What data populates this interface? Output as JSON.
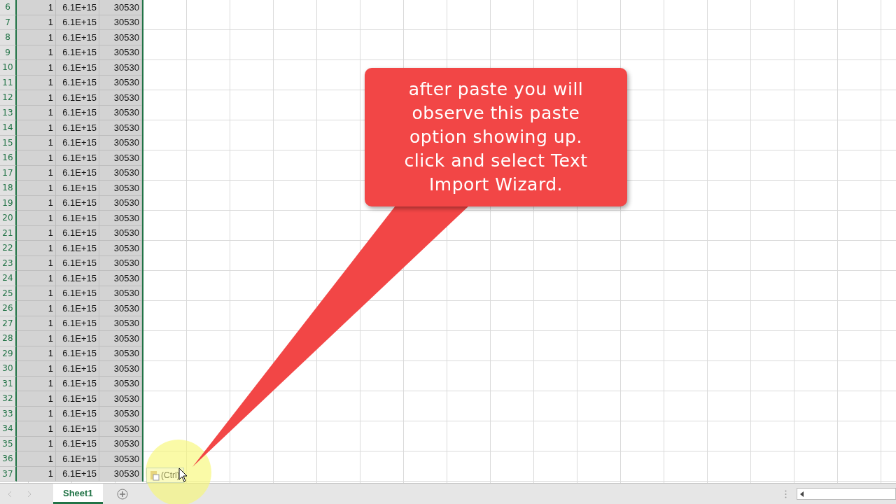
{
  "rows": [
    {
      "row": "6",
      "cells": [
        "1",
        "6.1E+15",
        "30530"
      ]
    },
    {
      "row": "7",
      "cells": [
        "1",
        "6.1E+15",
        "30530"
      ]
    },
    {
      "row": "8",
      "cells": [
        "1",
        "6.1E+15",
        "30530"
      ]
    },
    {
      "row": "9",
      "cells": [
        "1",
        "6.1E+15",
        "30530"
      ]
    },
    {
      "row": "10",
      "cells": [
        "1",
        "6.1E+15",
        "30530"
      ]
    },
    {
      "row": "11",
      "cells": [
        "1",
        "6.1E+15",
        "30530"
      ]
    },
    {
      "row": "12",
      "cells": [
        "1",
        "6.1E+15",
        "30530"
      ]
    },
    {
      "row": "13",
      "cells": [
        "1",
        "6.1E+15",
        "30530"
      ]
    },
    {
      "row": "14",
      "cells": [
        "1",
        "6.1E+15",
        "30530"
      ]
    },
    {
      "row": "15",
      "cells": [
        "1",
        "6.1E+15",
        "30530"
      ]
    },
    {
      "row": "16",
      "cells": [
        "1",
        "6.1E+15",
        "30530"
      ]
    },
    {
      "row": "17",
      "cells": [
        "1",
        "6.1E+15",
        "30530"
      ]
    },
    {
      "row": "18",
      "cells": [
        "1",
        "6.1E+15",
        "30530"
      ]
    },
    {
      "row": "19",
      "cells": [
        "1",
        "6.1E+15",
        "30530"
      ]
    },
    {
      "row": "20",
      "cells": [
        "1",
        "6.1E+15",
        "30530"
      ]
    },
    {
      "row": "21",
      "cells": [
        "1",
        "6.1E+15",
        "30530"
      ]
    },
    {
      "row": "22",
      "cells": [
        "1",
        "6.1E+15",
        "30530"
      ]
    },
    {
      "row": "23",
      "cells": [
        "1",
        "6.1E+15",
        "30530"
      ]
    },
    {
      "row": "24",
      "cells": [
        "1",
        "6.1E+15",
        "30530"
      ]
    },
    {
      "row": "25",
      "cells": [
        "1",
        "6.1E+15",
        "30530"
      ]
    },
    {
      "row": "26",
      "cells": [
        "1",
        "6.1E+15",
        "30530"
      ]
    },
    {
      "row": "27",
      "cells": [
        "1",
        "6.1E+15",
        "30530"
      ]
    },
    {
      "row": "28",
      "cells": [
        "1",
        "6.1E+15",
        "30530"
      ]
    },
    {
      "row": "29",
      "cells": [
        "1",
        "6.1E+15",
        "30530"
      ]
    },
    {
      "row": "30",
      "cells": [
        "1",
        "6.1E+15",
        "30530"
      ]
    },
    {
      "row": "31",
      "cells": [
        "1",
        "6.1E+15",
        "30530"
      ]
    },
    {
      "row": "32",
      "cells": [
        "1",
        "6.1E+15",
        "30530"
      ]
    },
    {
      "row": "33",
      "cells": [
        "1",
        "6.1E+15",
        "30530"
      ]
    },
    {
      "row": "34",
      "cells": [
        "1",
        "6.1E+15",
        "30530"
      ]
    },
    {
      "row": "35",
      "cells": [
        "1",
        "6.1E+15",
        "30530"
      ]
    },
    {
      "row": "36",
      "cells": [
        "1",
        "6.1E+15",
        "30530"
      ]
    },
    {
      "row": "37",
      "cells": [
        "1",
        "6.1E+15",
        "30530"
      ]
    }
  ],
  "paste_options": {
    "label": "(Ctrl)"
  },
  "callout": {
    "text": "after paste you will observe this paste option showing up. click and select Text Import Wizard."
  },
  "sheet_tabs": [
    {
      "label": "Sheet1",
      "selected": true
    }
  ]
}
